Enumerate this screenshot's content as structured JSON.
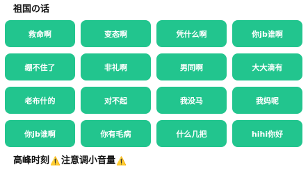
{
  "sections": [
    {
      "title": "祖国の话",
      "buttons": [
        "救命啊",
        "变态啊",
        "凭什么啊",
        "你jb谁啊",
        "绷不住了",
        "非礼啊",
        "男同啊",
        "大大滴有",
        "老布什的",
        "对不起",
        "我没马",
        "我妈呢",
        "你jb谁啊",
        "你有毛病",
        "什么几把",
        "hihi你好"
      ]
    },
    {
      "title_a": "高峰时刻",
      "title_b": "注意调小音量",
      "warn_icon": "warning-icon"
    }
  ],
  "colors": {
    "button_bg": "#22c58e",
    "button_text": "#ffffff",
    "title_text": "#111111"
  }
}
